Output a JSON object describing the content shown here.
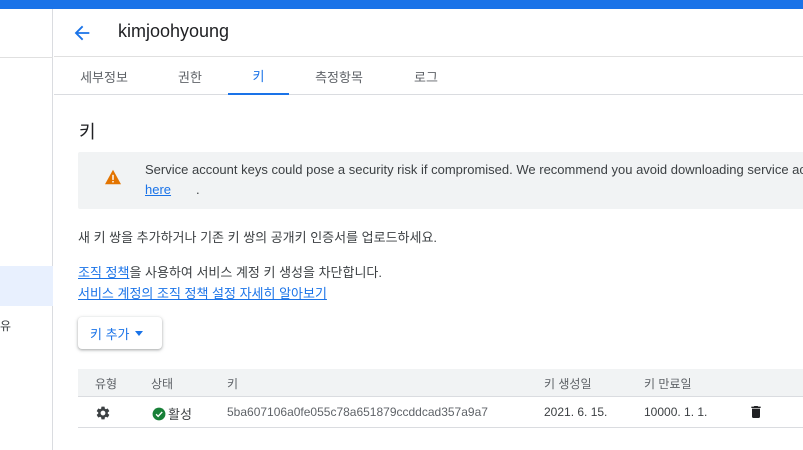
{
  "header": {
    "title": "kimjoohyoung"
  },
  "left_nav": {
    "partial_label": "유"
  },
  "tabs": [
    {
      "label": "세부정보"
    },
    {
      "label": "권한"
    },
    {
      "label": "키"
    },
    {
      "label": "측정항목"
    },
    {
      "label": "로그"
    }
  ],
  "active_tab": "키",
  "section": {
    "title": "키"
  },
  "alert": {
    "text": "Service account keys could pose a security risk if compromised. We recommend you avoid downloading service ac",
    "link": "here",
    "period": "."
  },
  "description": "새 키 쌍을 추가하거나 기존 키 쌍의 공개키 인증서를 업로드하세요.",
  "policy": {
    "link": "조직 정책",
    "rest": "을 사용하여 서비스 계정 키 생성을 차단합니다.",
    "learn_more": "서비스 계정의 조직 정책 설정 자세히 알아보기"
  },
  "add_key_button": {
    "label": "키 추가"
  },
  "table": {
    "headers": {
      "type": "유형",
      "status": "상태",
      "key": "키",
      "created": "키 생성일",
      "expires": "키 만료일"
    },
    "rows": [
      {
        "type_icon": "gear-icon",
        "status": "활성",
        "key": "5ba607106a0fe055c78a651879ccddcad357a9a7",
        "created": "2021. 6. 15.",
        "expires": "10000. 1. 1."
      }
    ]
  },
  "colors": {
    "accent": "#1a73e8",
    "warning": "#e37400",
    "active_status": "#188038"
  }
}
